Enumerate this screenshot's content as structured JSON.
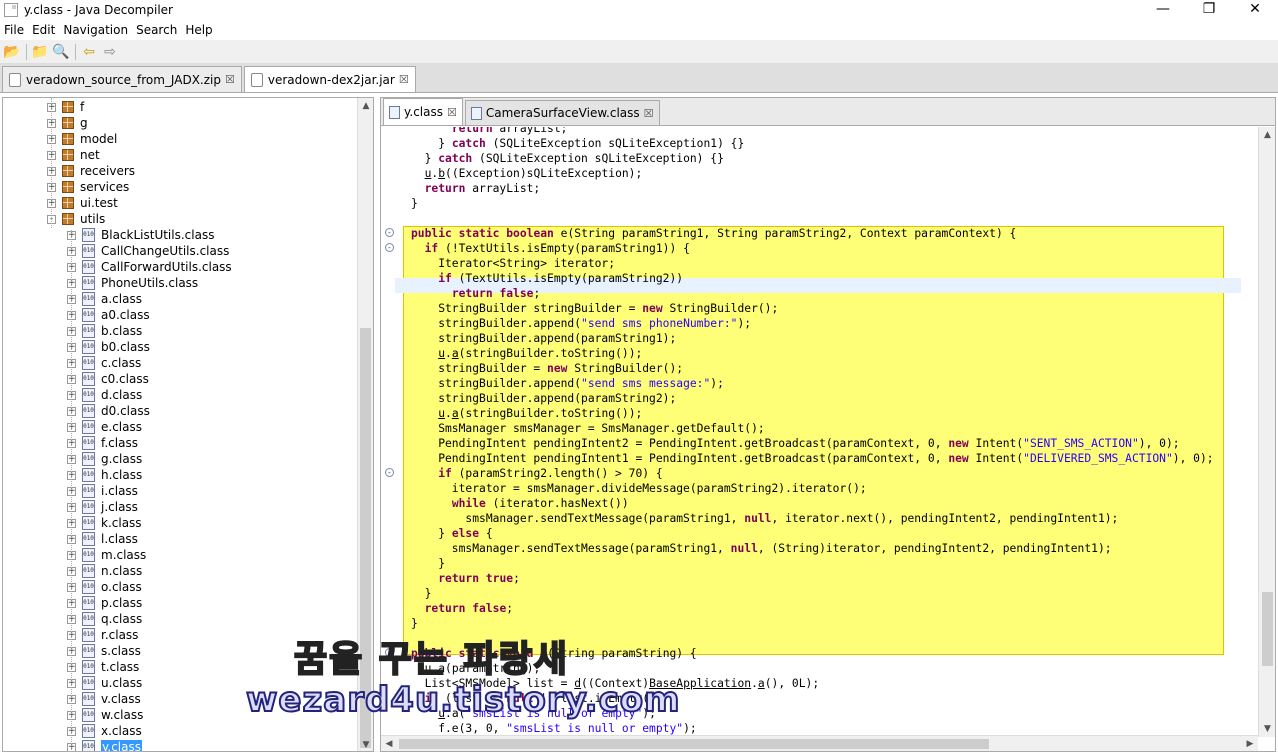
{
  "window": {
    "title": "y.class - Java Decompiler",
    "minimize": "—",
    "maximize": "❐",
    "close": "✕"
  },
  "menu": [
    "File",
    "Edit",
    "Navigation",
    "Search",
    "Help"
  ],
  "toolbar": {
    "open": "📂",
    "open_type": "📁",
    "search": "🔍",
    "back": "⇦",
    "forward": "⇨"
  },
  "outer_tabs": [
    {
      "label": "veradown_source_from_JADX.zip",
      "close": "☒"
    },
    {
      "label": "veradown-dex2jar.jar",
      "close": "☒"
    }
  ],
  "tree": {
    "packages": [
      "f",
      "g",
      "model",
      "net",
      "receivers",
      "services",
      "ui.test",
      "utils"
    ],
    "classes": [
      "BlackListUtils.class",
      "CallChangeUtils.class",
      "CallForwardUtils.class",
      "PhoneUtils.class",
      "a.class",
      "a0.class",
      "b.class",
      "b0.class",
      "c.class",
      "c0.class",
      "d.class",
      "d0.class",
      "e.class",
      "f.class",
      "g.class",
      "h.class",
      "i.class",
      "j.class",
      "k.class",
      "l.class",
      "m.class",
      "n.class",
      "o.class",
      "p.class",
      "q.class",
      "r.class",
      "s.class",
      "t.class",
      "u.class",
      "v.class",
      "w.class",
      "x.class",
      "y.class"
    ],
    "selected": "y.class",
    "expand_plus": "+",
    "expand_minus": "-",
    "class_icon_text": "010"
  },
  "editor_tabs": [
    {
      "label": "y.class",
      "close": "☒"
    },
    {
      "label": "CameraSurfaceView.class",
      "close": "☒"
    }
  ],
  "code_lines": [
    [
      [
        "",
        "      "
      ],
      [
        "kw",
        "return"
      ],
      [
        "",
        " arrayList;"
      ]
    ],
    [
      [
        "",
        "    } "
      ],
      [
        "kw",
        "catch"
      ],
      [
        "",
        " (SQLiteException sQLiteException1) {}"
      ]
    ],
    [
      [
        "",
        "  } "
      ],
      [
        "kw",
        "catch"
      ],
      [
        "",
        " (SQLiteException sQLiteException) {}"
      ]
    ],
    [
      [
        "",
        "  "
      ],
      [
        "u",
        "u"
      ],
      [
        "",
        "."
      ],
      [
        "u",
        "b"
      ],
      [
        "",
        "((Exception)sQLiteException);"
      ]
    ],
    [
      [
        "",
        "  "
      ],
      [
        "kw",
        "return"
      ],
      [
        "",
        " arrayList;"
      ]
    ],
    [
      [
        "",
        "}"
      ]
    ],
    [
      [
        "",
        ""
      ]
    ],
    [
      [
        "kw",
        "public"
      ],
      [
        "",
        " "
      ],
      [
        "kw",
        "static"
      ],
      [
        "",
        " "
      ],
      [
        "kw",
        "boolean"
      ],
      [
        "",
        " e(String paramString1, String paramString2, Context paramContext) {"
      ]
    ],
    [
      [
        "",
        "  "
      ],
      [
        "kw",
        "if"
      ],
      [
        "",
        " (!TextUtils.isEmpty(paramString1)) {"
      ]
    ],
    [
      [
        "",
        "    Iterator<String> iterator;"
      ]
    ],
    [
      [
        "",
        "    "
      ],
      [
        "kw",
        "if"
      ],
      [
        "",
        " (TextUtils.isEmpty(paramString2))"
      ]
    ],
    [
      [
        "",
        "      "
      ],
      [
        "kw",
        "return"
      ],
      [
        "",
        " "
      ],
      [
        "kw",
        "false"
      ],
      [
        "",
        ";"
      ]
    ],
    [
      [
        "",
        "    StringBuilder stringBuilder = "
      ],
      [
        "kw",
        "new"
      ],
      [
        "",
        " StringBuilder();"
      ]
    ],
    [
      [
        "",
        "    stringBuilder.append("
      ],
      [
        "str",
        "\"send sms phoneNumber:\""
      ],
      [
        "",
        ");"
      ]
    ],
    [
      [
        "",
        "    stringBuilder.append(paramString1);"
      ]
    ],
    [
      [
        "",
        "    "
      ],
      [
        "u",
        "u"
      ],
      [
        "",
        "."
      ],
      [
        "u",
        "a"
      ],
      [
        "",
        "(stringBuilder.toString());"
      ]
    ],
    [
      [
        "",
        "    stringBuilder = "
      ],
      [
        "kw",
        "new"
      ],
      [
        "",
        " StringBuilder();"
      ]
    ],
    [
      [
        "",
        "    stringBuilder.append("
      ],
      [
        "str",
        "\"send sms message:\""
      ],
      [
        "",
        ");"
      ]
    ],
    [
      [
        "",
        "    stringBuilder.append(paramString2);"
      ]
    ],
    [
      [
        "",
        "    "
      ],
      [
        "u",
        "u"
      ],
      [
        "",
        "."
      ],
      [
        "u",
        "a"
      ],
      [
        "",
        "(stringBuilder.toString());"
      ]
    ],
    [
      [
        "",
        "    SmsManager smsManager = SmsManager.getDefault();"
      ]
    ],
    [
      [
        "",
        "    PendingIntent pendingIntent2 = PendingIntent.getBroadcast(paramContext, 0, "
      ],
      [
        "kw",
        "new"
      ],
      [
        "",
        " Intent("
      ],
      [
        "str",
        "\"SENT_SMS_ACTION\""
      ],
      [
        "",
        "), 0);"
      ]
    ],
    [
      [
        "",
        "    PendingIntent pendingIntent1 = PendingIntent.getBroadcast(paramContext, 0, "
      ],
      [
        "kw",
        "new"
      ],
      [
        "",
        " Intent("
      ],
      [
        "str",
        "\"DELIVERED_SMS_ACTION\""
      ],
      [
        "",
        "), 0);"
      ]
    ],
    [
      [
        "",
        "    "
      ],
      [
        "kw",
        "if"
      ],
      [
        "",
        " (paramString2.length() > 70) {"
      ]
    ],
    [
      [
        "",
        "      iterator = smsManager.divideMessage(paramString2).iterator();"
      ]
    ],
    [
      [
        "",
        "      "
      ],
      [
        "kw",
        "while"
      ],
      [
        "",
        " (iterator.hasNext())"
      ]
    ],
    [
      [
        "",
        "        smsManager.sendTextMessage(paramString1, "
      ],
      [
        "kw",
        "null"
      ],
      [
        "",
        ", iterator.next(), pendingIntent2, pendingIntent1);"
      ]
    ],
    [
      [
        "",
        "    } "
      ],
      [
        "kw",
        "else"
      ],
      [
        "",
        " {"
      ]
    ],
    [
      [
        "",
        "      smsManager.sendTextMessage(paramString1, "
      ],
      [
        "kw",
        "null"
      ],
      [
        "",
        ", (String)iterator, pendingIntent2, pendingIntent1);"
      ]
    ],
    [
      [
        "",
        "    }"
      ]
    ],
    [
      [
        "",
        "    "
      ],
      [
        "kw",
        "return"
      ],
      [
        "",
        " "
      ],
      [
        "kw",
        "true"
      ],
      [
        "",
        ";"
      ]
    ],
    [
      [
        "",
        "  }"
      ]
    ],
    [
      [
        "",
        "  "
      ],
      [
        "kw",
        "return"
      ],
      [
        "",
        " "
      ],
      [
        "kw",
        "false"
      ],
      [
        "",
        ";"
      ]
    ],
    [
      [
        "",
        "}"
      ]
    ],
    [
      [
        "",
        ""
      ]
    ],
    [
      [
        "kw",
        "public"
      ],
      [
        "",
        " "
      ],
      [
        "kw",
        "static"
      ],
      [
        "",
        " "
      ],
      [
        "kw",
        "void"
      ],
      [
        "",
        " e(String paramString) {"
      ]
    ],
    [
      [
        "",
        "  "
      ],
      [
        "u",
        "u"
      ],
      [
        "",
        ".a(paramString);"
      ]
    ],
    [
      [
        "",
        "  List<SMSModel> list = "
      ],
      [
        "u",
        "d"
      ],
      [
        "",
        "((Context)"
      ],
      [
        "u",
        "BaseApplication"
      ],
      [
        "",
        "."
      ],
      [
        "u",
        "a"
      ],
      [
        "",
        "(), 0L);"
      ]
    ],
    [
      [
        "",
        "  "
      ],
      [
        "kw",
        "if"
      ],
      [
        "",
        " (list == "
      ],
      [
        "kw",
        "null"
      ],
      [
        "",
        " || list.isEmpty()) {"
      ]
    ],
    [
      [
        "",
        "    "
      ],
      [
        "u",
        "u"
      ],
      [
        "",
        ".a("
      ],
      [
        "str",
        "\"smsList is null or empty\""
      ],
      [
        "",
        ");"
      ]
    ],
    [
      [
        "",
        "    f.e(3, 0, "
      ],
      [
        "str",
        "\"smsList is null or empty\""
      ],
      [
        "",
        ");"
      ]
    ]
  ],
  "watermark": {
    "line1": "꿈을 꾸는 파랑새",
    "line2": "wezard4u.tistory.com"
  },
  "scroll_arrows": {
    "up": "▲",
    "down": "▼",
    "left": "◀",
    "right": "▶"
  }
}
